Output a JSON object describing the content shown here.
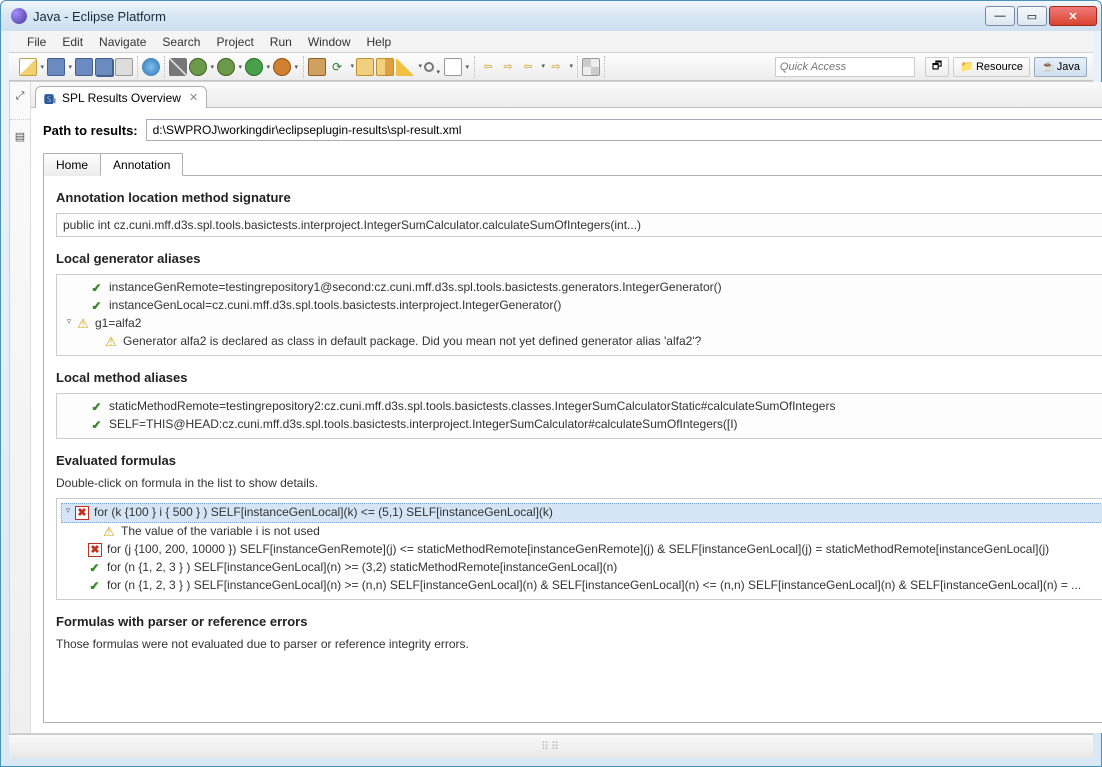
{
  "window": {
    "title": "Java - Eclipse Platform"
  },
  "menubar": [
    "File",
    "Edit",
    "Navigate",
    "Search",
    "Project",
    "Run",
    "Window",
    "Help"
  ],
  "quick_access_placeholder": "Quick Access",
  "perspectives": {
    "resource": "Resource",
    "java": "Java"
  },
  "view": {
    "tab_title": "SPL Results Overview",
    "path_label": "Path to results:",
    "path_value": "d:\\SWPROJ\\workingdir\\eclipseplugin-results\\spl-result.xml",
    "tabs": {
      "home": "Home",
      "annotation": "Annotation"
    }
  },
  "annotation": {
    "heading_signature": "Annotation location method signature",
    "signature": "public int cz.cuni.mff.d3s.spl.tools.basictests.interproject.IntegerSumCalculator.calculateSumOfIntegers(int...)",
    "heading_gen": "Local generator aliases",
    "gen_items": [
      {
        "status": "ok",
        "indent": 1,
        "expander": "",
        "text": "instanceGenRemote=testingrepository1@second:cz.cuni.mff.d3s.spl.tools.basictests.generators.IntegerGenerator()"
      },
      {
        "status": "ok",
        "indent": 1,
        "expander": "",
        "text": "instanceGenLocal=cz.cuni.mff.d3s.spl.tools.basictests.interproject.IntegerGenerator()"
      },
      {
        "status": "warn",
        "indent": 0,
        "expander": "▿",
        "text": "g1=alfa2"
      },
      {
        "status": "warn",
        "indent": 2,
        "expander": "",
        "text": "Generator alfa2 is declared as class in default package. Did you mean not yet defined generator alias 'alfa2'?"
      }
    ],
    "heading_method": "Local method aliases",
    "method_items": [
      {
        "status": "ok",
        "text": "staticMethodRemote=testingrepository2:cz.cuni.mff.d3s.spl.tools.basictests.classes.IntegerSumCalculatorStatic#calculateSumOfIntegers"
      },
      {
        "status": "ok",
        "text": "SELF=THIS@HEAD:cz.cuni.mff.d3s.spl.tools.basictests.interproject.IntegerSumCalculator#calculateSumOfIntegers([I)"
      }
    ],
    "heading_formulas": "Evaluated formulas",
    "formulas_hint": "Double-click on formula in the list to show details.",
    "formula_items": [
      {
        "status": "err",
        "indent": 0,
        "expander": "▿",
        "selected": true,
        "text": "for (k {100 } i { 500 } ) SELF[instanceGenLocal](k) <= (5,1) SELF[instanceGenLocal](k)"
      },
      {
        "status": "warn",
        "indent": 2,
        "expander": "",
        "selected": false,
        "text": "The value of the variable i is not used"
      },
      {
        "status": "err",
        "indent": 1,
        "expander": "",
        "selected": false,
        "text": "for (j {100, 200, 10000 }) SELF[instanceGenRemote](j) <= staticMethodRemote[instanceGenRemote](j) & SELF[instanceGenLocal](j) = staticMethodRemote[instanceGenLocal](j)"
      },
      {
        "status": "ok",
        "indent": 1,
        "expander": "",
        "selected": false,
        "text": "for (n {1, 2, 3 } ) SELF[instanceGenLocal](n) >= (3,2) staticMethodRemote[instanceGenLocal](n)"
      },
      {
        "status": "ok",
        "indent": 1,
        "expander": "",
        "selected": false,
        "text": "for (n {1, 2, 3 } ) SELF[instanceGenLocal](n) >= (n,n) SELF[instanceGenLocal](n) & SELF[instanceGenLocal](n) <= (n,n) SELF[instanceGenLocal](n) & SELF[instanceGenLocal](n) = ..."
      }
    ],
    "heading_errors": "Formulas with parser or reference errors",
    "errors_hint": "Those formulas were not evaluated due to parser or reference integrity errors."
  }
}
